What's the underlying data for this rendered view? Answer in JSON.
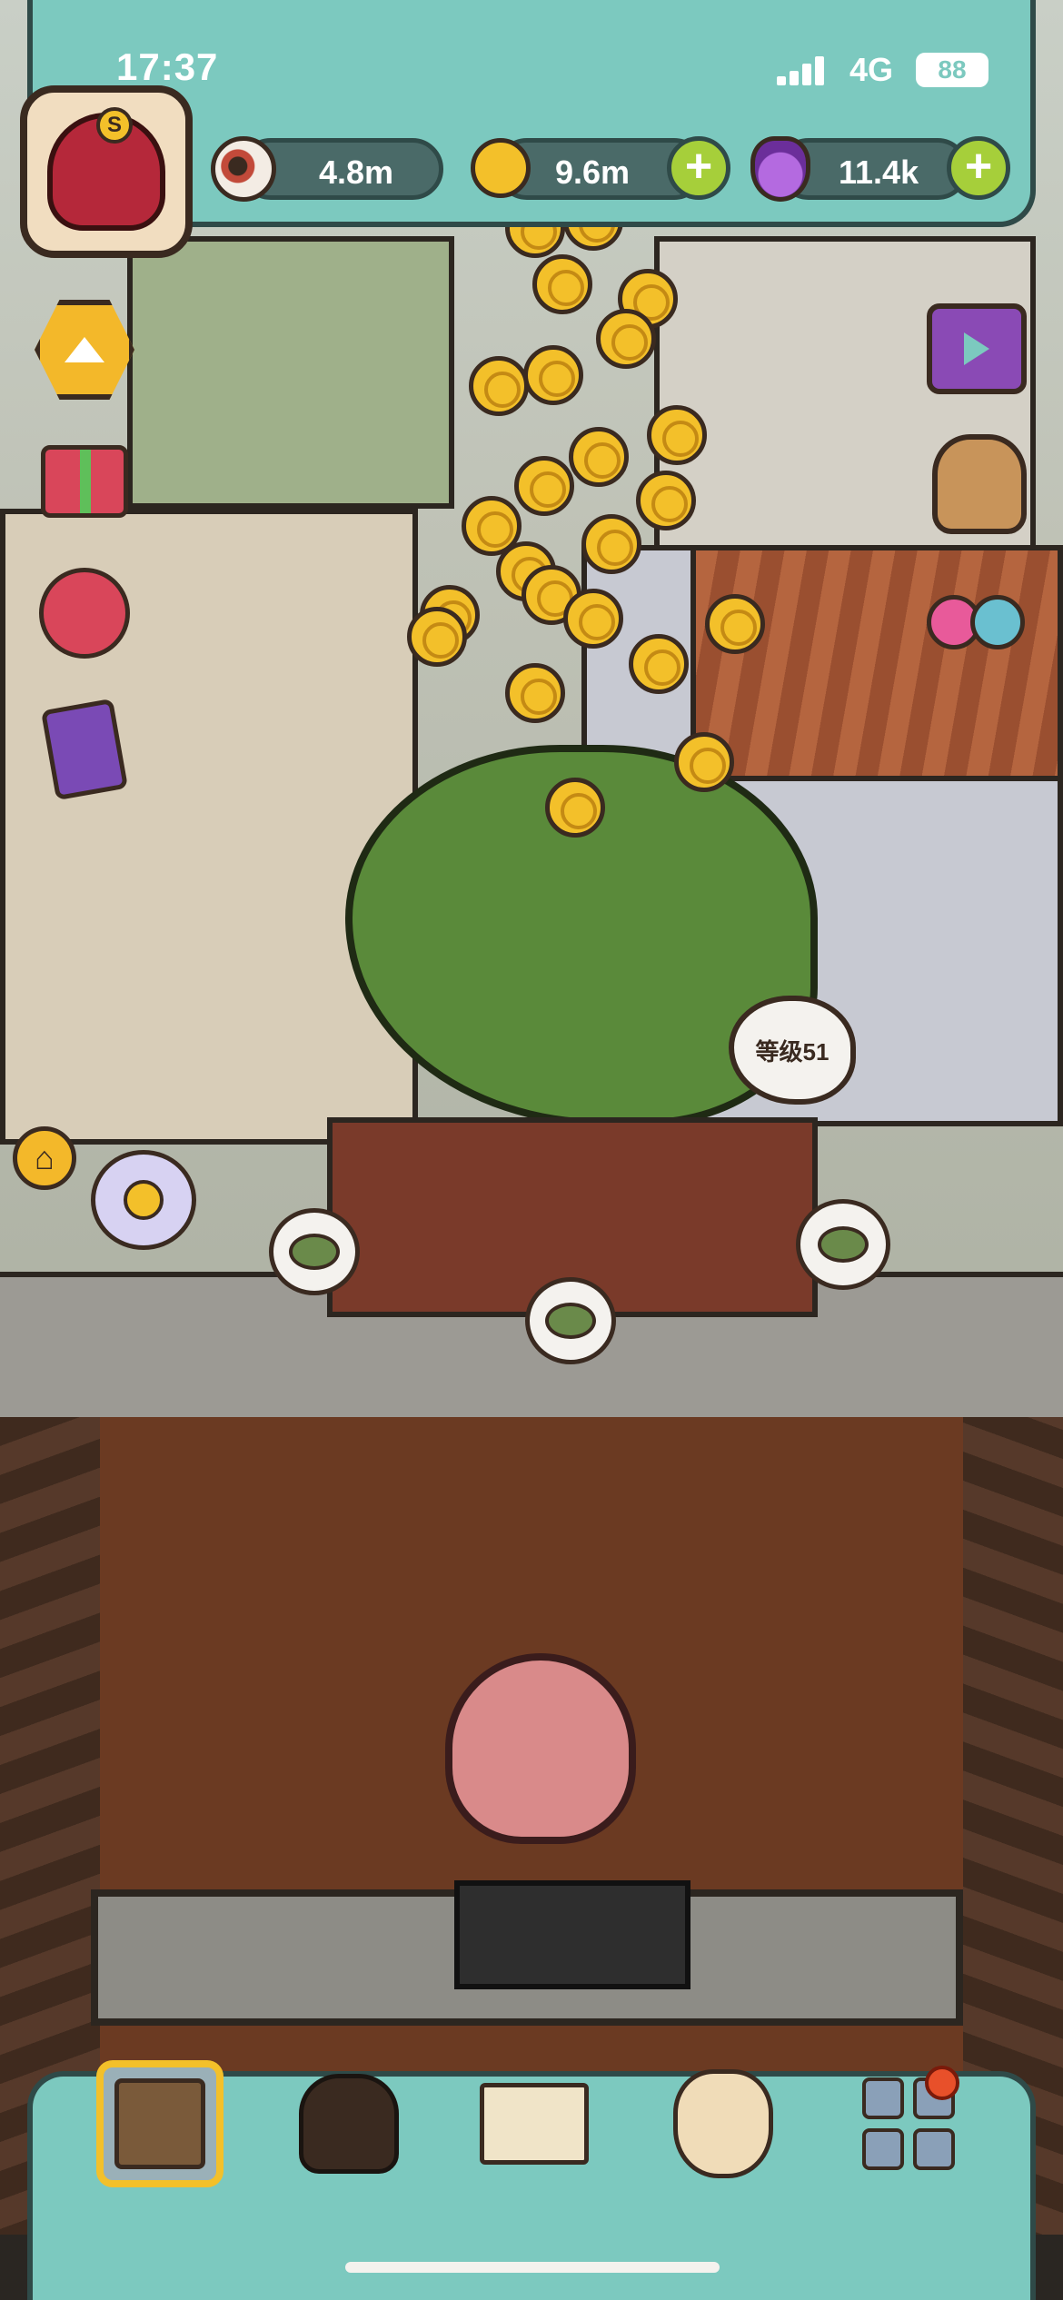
{
  "status_bar": {
    "time": "17:37",
    "network": "4G",
    "battery": "88"
  },
  "resources": {
    "eyeballs": "4.8m",
    "coins": "9.6m",
    "potions": "11.4k",
    "plus_label": "+"
  },
  "avatar": {
    "rank": "S"
  },
  "shop": {
    "level_label": "等级51"
  },
  "side_buttons": {
    "home_glyph": "⌂"
  },
  "icons": {
    "eye": "eyeball-icon",
    "coin": "coin-icon",
    "potion": "potion-icon"
  },
  "colors": {
    "panel": "#7cc9bf",
    "coin": "#f3c02a",
    "plus": "#a6cf3a",
    "notification": "#e8502a"
  }
}
